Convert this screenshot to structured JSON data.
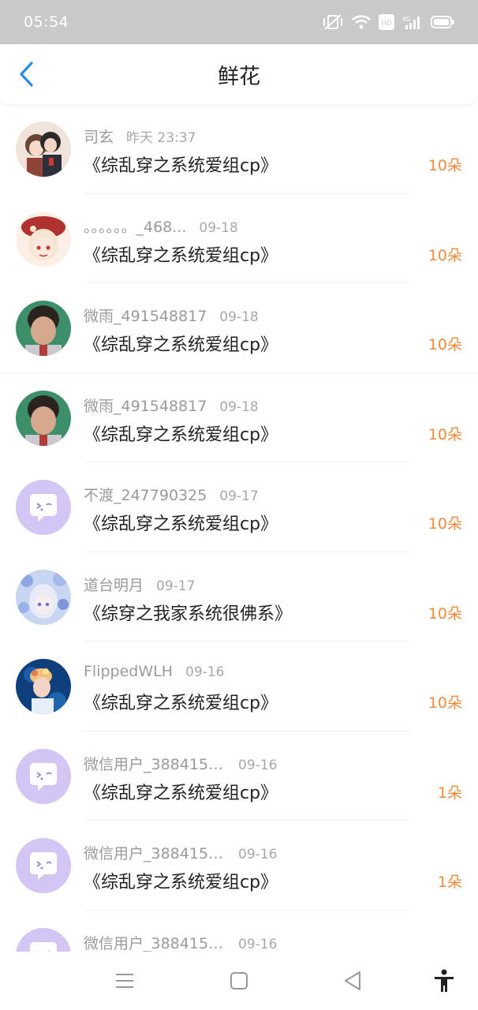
{
  "status_bar": {
    "time": "05:54",
    "icons": [
      "vibrate-off-icon",
      "wifi-icon",
      "hd-icon",
      "4g-signal-icon",
      "battery-icon"
    ],
    "hd_text": "HD",
    "net_text": "4G"
  },
  "header": {
    "title": "鲜花",
    "back_icon": "chevron-left-icon"
  },
  "colors": {
    "accent_blue": "#2a8ce8",
    "flower_count_orange": "#f08a3c",
    "default_avatar_bg": "#d4c6f4"
  },
  "flowers": [
    {
      "user": "司玄",
      "time": "昨天 23:37",
      "book": "《综乱穿之系统爱组cp》",
      "count": "10朵",
      "avatar": "anime-couple"
    },
    {
      "user": "。。。。。。_468...",
      "time": "09-18",
      "book": "《综乱穿之系统爱组cp》",
      "count": "10朵",
      "avatar": "anime-red-hat"
    },
    {
      "user": "微雨_491548817",
      "time": "09-18",
      "book": "《综乱穿之系统爱组cp》",
      "count": "10朵",
      "avatar": "photo-child"
    },
    {
      "user": "微雨_491548817",
      "time": "09-18",
      "book": "《综乱穿之系统爱组cp》",
      "count": "10朵",
      "avatar": "photo-child"
    },
    {
      "user": "不渡_247790325",
      "time": "09-17",
      "book": "《综乱穿之系统爱组cp》",
      "count": "10朵",
      "avatar": "default"
    },
    {
      "user": "道台明月",
      "time": "09-17",
      "book": "《综穿之我家系统很佛系》",
      "count": "10朵",
      "avatar": "anime-blue-flowers"
    },
    {
      "user": "FlippedWLH",
      "time": "09-16",
      "book": "《综乱穿之系统爱组cp》",
      "count": "10朵",
      "avatar": "photo-singer"
    },
    {
      "user": "微信用户_3884153...",
      "time": "09-16",
      "book": "《综乱穿之系统爱组cp》",
      "count": "1朵",
      "avatar": "default"
    },
    {
      "user": "微信用户_3884153...",
      "time": "09-16",
      "book": "《综乱穿之系统爱组cp》",
      "count": "1朵",
      "avatar": "default"
    },
    {
      "user": "微信用户_3884153...",
      "time": "09-16",
      "book": "",
      "count": "",
      "avatar": "default"
    }
  ],
  "nav_bar": {
    "icons": [
      "menu-icon",
      "home-square-icon",
      "back-triangle-icon",
      "accessibility-icon"
    ]
  }
}
